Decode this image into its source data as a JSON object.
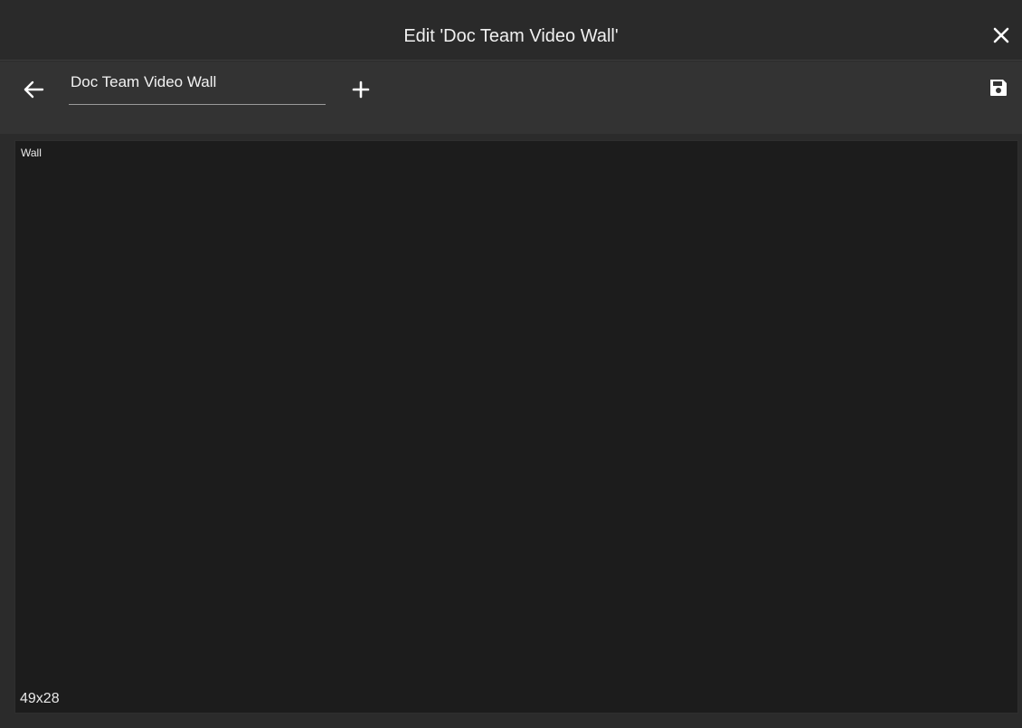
{
  "window": {
    "title": "Edit 'Doc Team Video Wall'",
    "close_icon": "close-icon"
  },
  "toolbar": {
    "back_icon": "arrow-left-icon",
    "name_value": "Doc Team Video Wall",
    "add_icon": "plus-icon",
    "save_icon": "floppy-disk-icon"
  },
  "canvas": {
    "label": "Wall",
    "size": "49x28"
  },
  "colors": {
    "background": "#2b2b2b",
    "toolbar": "#333333",
    "canvas": "#1c1c1c",
    "text": "#e6e6e6"
  }
}
